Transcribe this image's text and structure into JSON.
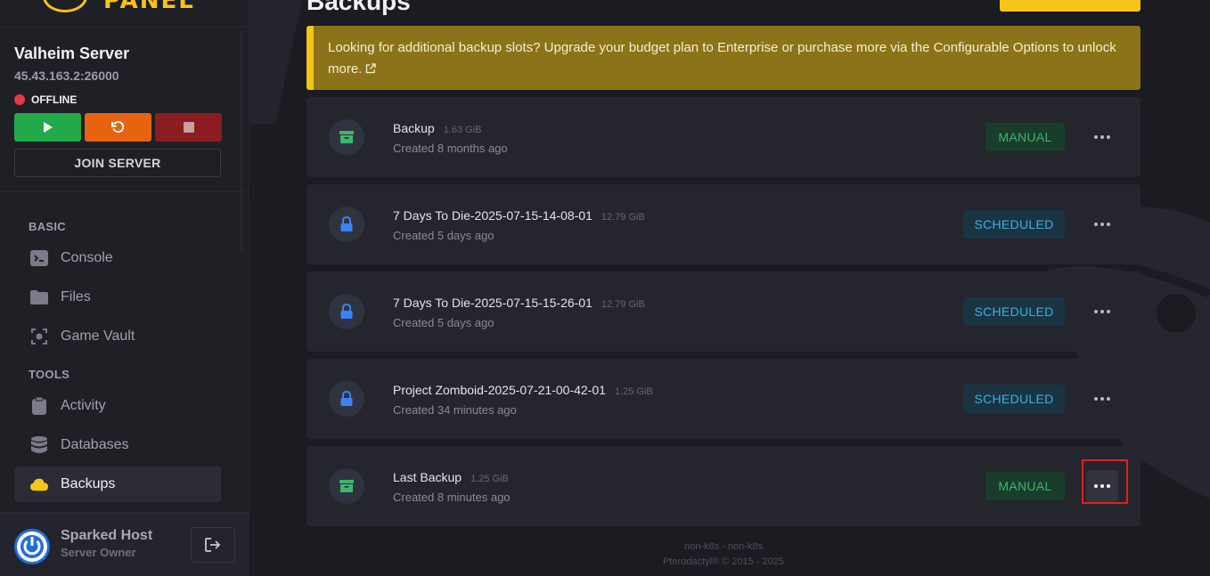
{
  "logo": {
    "text": "PANEL"
  },
  "server": {
    "name": "Valheim Server",
    "ip": "45.43.163.2:26000",
    "status": "OFFLINE",
    "status_color": "#ea3a3a"
  },
  "power": {
    "start_icon": "play-icon",
    "restart_icon": "restart-icon",
    "stop_icon": "stop-icon",
    "join_label": "JOIN SERVER"
  },
  "nav": {
    "section_basic": "BASIC",
    "section_tools": "TOOLS",
    "items": [
      {
        "label": "Console",
        "icon": "console-icon"
      },
      {
        "label": "Files",
        "icon": "folder-icon"
      },
      {
        "label": "Game Vault",
        "icon": "vault-icon"
      },
      {
        "label": "Activity",
        "icon": "clipboard-icon"
      },
      {
        "label": "Databases",
        "icon": "database-icon"
      },
      {
        "label": "Backups",
        "icon": "cloud-icon",
        "active": true
      }
    ]
  },
  "user": {
    "name": "Sparked Host",
    "role": "Server Owner"
  },
  "page": {
    "title": "Backups"
  },
  "notice": {
    "text": "Looking for additional backup slots? Upgrade your budget plan to Enterprise or purchase more via the Configurable Options to unlock more."
  },
  "backups": [
    {
      "name": "Backup",
      "size": "1.63 GiB",
      "created": "Created 8 months ago",
      "badge": "MANUAL",
      "locked": false
    },
    {
      "name": "7 Days To Die-2025-07-15-14-08-01",
      "size": "12.79 GiB",
      "created": "Created 5 days ago",
      "badge": "SCHEDULED",
      "locked": true
    },
    {
      "name": "7 Days To Die-2025-07-15-15-26-01",
      "size": "12.79 GiB",
      "created": "Created 5 days ago",
      "badge": "SCHEDULED",
      "locked": true
    },
    {
      "name": "Project Zomboid-2025-07-21-00-42-01",
      "size": "1.25 GiB",
      "created": "Created 34 minutes ago",
      "badge": "SCHEDULED",
      "locked": true
    },
    {
      "name": "Last Backup",
      "size": "1.25 GiB",
      "created": "Created 8 minutes ago",
      "badge": "MANUAL",
      "locked": false
    }
  ],
  "footer": {
    "line1": "non-k8s - non-k8s",
    "line2": "Pterodactyl® © 2015 - 2025"
  },
  "colors": {
    "accent": "#f5c518",
    "manual": "#3fb56b",
    "scheduled": "#3ab0e0",
    "lock": "#3b82f6"
  }
}
